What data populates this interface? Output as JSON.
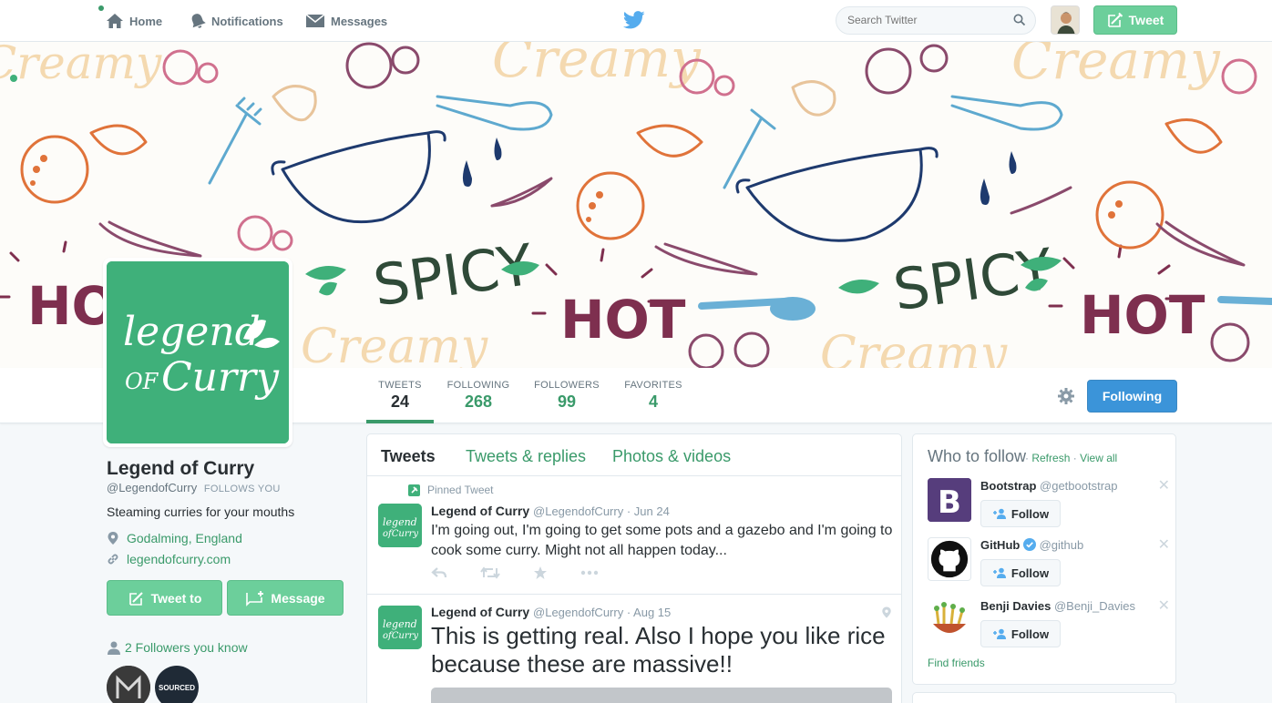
{
  "nav": {
    "home": "Home",
    "notifications": "Notifications",
    "messages": "Messages",
    "search_placeholder": "Search Twitter",
    "tweet_button": "Tweet"
  },
  "stats": [
    {
      "label": "TWEETS",
      "value": "24"
    },
    {
      "label": "FOLLOWING",
      "value": "268"
    },
    {
      "label": "FOLLOWERS",
      "value": "99"
    },
    {
      "label": "FAVORITES",
      "value": "4"
    }
  ],
  "following_button": "Following",
  "profile": {
    "avatar_text": "Legend of Curry",
    "name": "Legend of Curry",
    "handle": "@LegendofCurry",
    "follows_you": "FOLLOWS YOU",
    "bio": "Steaming curries for your mouths",
    "location": "Godalming, England",
    "website": "legendofcurry.com",
    "tweet_to": "Tweet to",
    "message": "Message",
    "followers_you_know": "2 Followers you know",
    "mini_avatar_2": "SOURCED"
  },
  "banner": {
    "words": [
      "Creamy",
      "SPICY",
      "HOT"
    ]
  },
  "timeline": {
    "tabs": [
      "Tweets",
      "Tweets & replies",
      "Photos & videos"
    ],
    "tweets": [
      {
        "pinned_label": "Pinned Tweet",
        "name": "Legend of Curry",
        "handle": "@LegendofCurry · Jun 24",
        "text": "I'm going out, I'm going to get some pots and a gazebo and I'm going to cook some curry. Might not all happen today..."
      },
      {
        "name": "Legend of Curry",
        "handle": "@LegendofCurry · Aug 15",
        "text": "This is getting real. Also I hope you like rice because these are massive!!"
      }
    ]
  },
  "who_to_follow": {
    "title": "Who to follow",
    "refresh": "Refresh",
    "view_all": "View all",
    "follow_label": "Follow",
    "find_friends": "Find friends",
    "suggestions": [
      {
        "name": "Bootstrap",
        "handle": "@getbootstrap"
      },
      {
        "name": "GitHub",
        "handle": "@github"
      },
      {
        "name": "Benji Davies",
        "handle": "@Benji_Davies"
      }
    ]
  },
  "colors": {
    "accent": "#3a9a6a",
    "brand_green": "#3fb07a",
    "following_blue": "#3b94d9"
  }
}
